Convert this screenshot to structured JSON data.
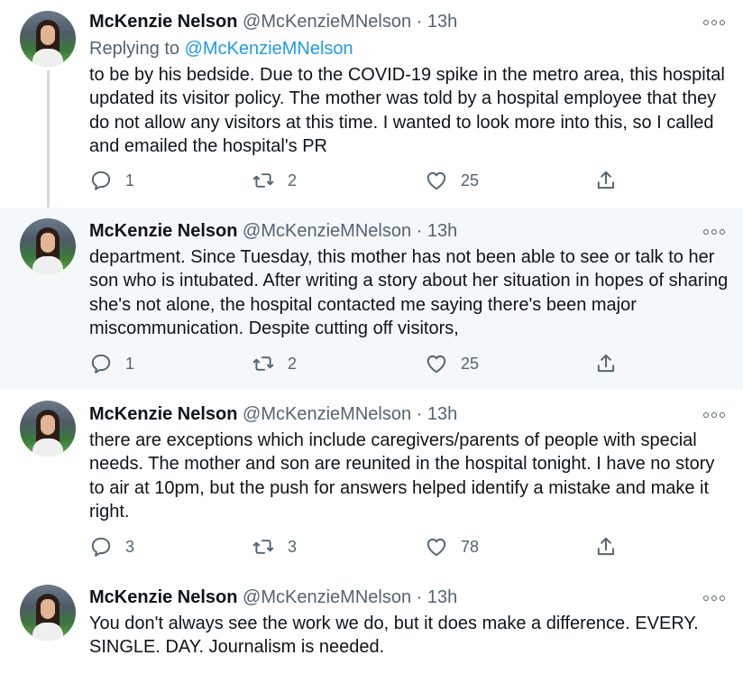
{
  "author": {
    "name": "McKenzie Nelson",
    "handle": "@McKenzieMNelson",
    "separator": "·",
    "time": "13h"
  },
  "tweets": [
    {
      "replying_prefix": "Replying to ",
      "replying_to": "@McKenzieMNelson",
      "text": "to be by his bedside. Due to the COVID-19 spike in the metro area, this hospital updated its visitor policy. The mother was told by a hospital employee that they do not allow any visitors at this time. I wanted to look more into this, so I called and emailed the hospital's PR",
      "replies": "1",
      "retweets": "2",
      "likes": "25"
    },
    {
      "text": "department. Since Tuesday, this mother has not been able to see or talk to her son who is intubated. After writing a story about her situation in hopes of sharing she's not alone, the hospital contacted me saying there's been major miscommunication. Despite cutting off visitors,",
      "replies": "1",
      "retweets": "2",
      "likes": "25"
    },
    {
      "text": "there are exceptions which include caregivers/parents of people with special needs. The mother and son are reunited in the hospital tonight. I have no story to air at 10pm, but the push for answers helped identify a mistake and make it right.",
      "replies": "3",
      "retweets": "3",
      "likes": "78"
    },
    {
      "text": "You don't always see the work we do, but it does make a difference. EVERY. SINGLE. DAY. Journalism is needed."
    }
  ],
  "icons": {
    "reply": "reply-icon",
    "retweet": "retweet-icon",
    "like": "heart-icon",
    "share": "share-icon",
    "more": "more-icon"
  },
  "colors": {
    "highlight_bg": "#f5f8fa",
    "link": "#1d9bf0",
    "muted": "#536471",
    "thread_line": "#cfd9de"
  }
}
